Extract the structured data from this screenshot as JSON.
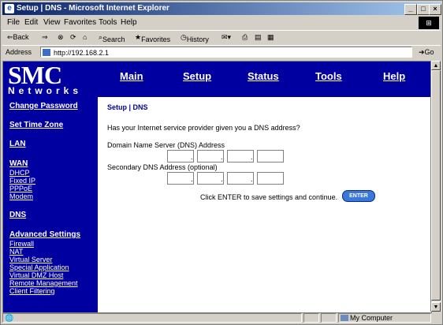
{
  "window": {
    "title": "Setup | DNS - Microsoft Internet Explorer"
  },
  "menu": [
    "File",
    "Edit",
    "View",
    "Favorites",
    "Tools",
    "Help"
  ],
  "toolbar": {
    "back": "⇐Back",
    "forward": "⇒",
    "search": "Search",
    "favorites": "Favorites",
    "history": "History"
  },
  "address": {
    "label": "Address",
    "url": "http://192.168.2.1",
    "go": "Go"
  },
  "logo": {
    "main": "SMC",
    "sub": "Networks"
  },
  "nav": [
    "Main",
    "Setup",
    "Status",
    "Tools",
    "Help"
  ],
  "sidebar": [
    {
      "label": "Change Password",
      "head": true
    },
    {
      "label": "Set Time Zone",
      "head": true
    },
    {
      "label": "LAN",
      "head": true
    },
    {
      "label": "WAN",
      "head": true
    },
    {
      "label": "DHCP",
      "head": false
    },
    {
      "label": "Fixed IP",
      "head": false
    },
    {
      "label": "PPPoE",
      "head": false
    },
    {
      "label": "Modem",
      "head": false
    },
    {
      "label": "DNS",
      "head": true
    },
    {
      "label": "Advanced Settings",
      "head": true
    },
    {
      "label": "Firewall",
      "head": false
    },
    {
      "label": "NAT",
      "head": false
    },
    {
      "label": "Virtual Server",
      "head": false
    },
    {
      "label": "Special Application",
      "head": false
    },
    {
      "label": "Virtual DMZ Host",
      "head": false
    },
    {
      "label": "Remote Management",
      "head": false
    },
    {
      "label": "Client Filtering",
      "head": false
    }
  ],
  "page": {
    "breadcrumb": "Setup | DNS",
    "question": "Has your Internet service provider given you a DNS address?",
    "dns_label": "Domain Name Server (DNS) Address",
    "secondary_label": "Secondary DNS Address (optional)",
    "hint": "Click ENTER to save settings and continue.",
    "enter": "ENTER"
  },
  "dns": {
    "primary": [
      "",
      "",
      "",
      ""
    ],
    "secondary": [
      "",
      "",
      "",
      ""
    ]
  },
  "statusbar": {
    "zone": "My Computer"
  },
  "colors": {
    "brand": "#0000a0",
    "enter": "#3a78d8"
  }
}
